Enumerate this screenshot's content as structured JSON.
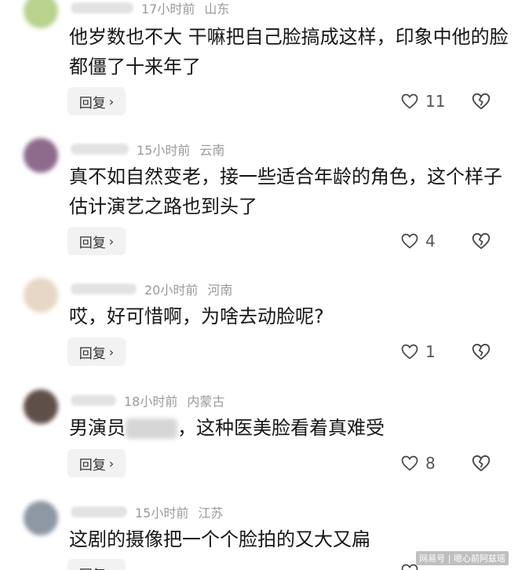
{
  "reply_label": "回复",
  "reply_chevron": "›",
  "comments": [
    {
      "username": "",
      "time": "17小时前",
      "location": "山东",
      "text": "他岁数也不大 干嘛把自己脸搞成这样，印象中他的脸都僵了十来年了",
      "likes": "11",
      "avatar_color": "#b9d28e"
    },
    {
      "username": "",
      "time": "15小时前",
      "location": "云南",
      "text": "真不如自然变老，接一些适合年龄的角色，这个样子估计演艺之路也到头了",
      "likes": "4",
      "avatar_color": "#8e6a8c"
    },
    {
      "username": "",
      "time": "20小时前",
      "location": "河南",
      "text": "哎，好可惜啊，为啥去动脸呢?",
      "likes": "1",
      "avatar_color": "#e6d7c6"
    },
    {
      "username": "",
      "time": "18小时前",
      "location": "内蒙古",
      "text_before": "男演员",
      "text_after": "，这种医美脸看着真难受",
      "likes": "8",
      "avatar_color": "#5e5048"
    },
    {
      "username": "",
      "time": "15小时前",
      "location": "江苏",
      "text": "这剧的摄像把一个个脸拍的又大又扁",
      "likes": "",
      "avatar_color": "#8d98a3"
    }
  ],
  "watermark": "网易号 | 嗯心前阿兹瑶"
}
